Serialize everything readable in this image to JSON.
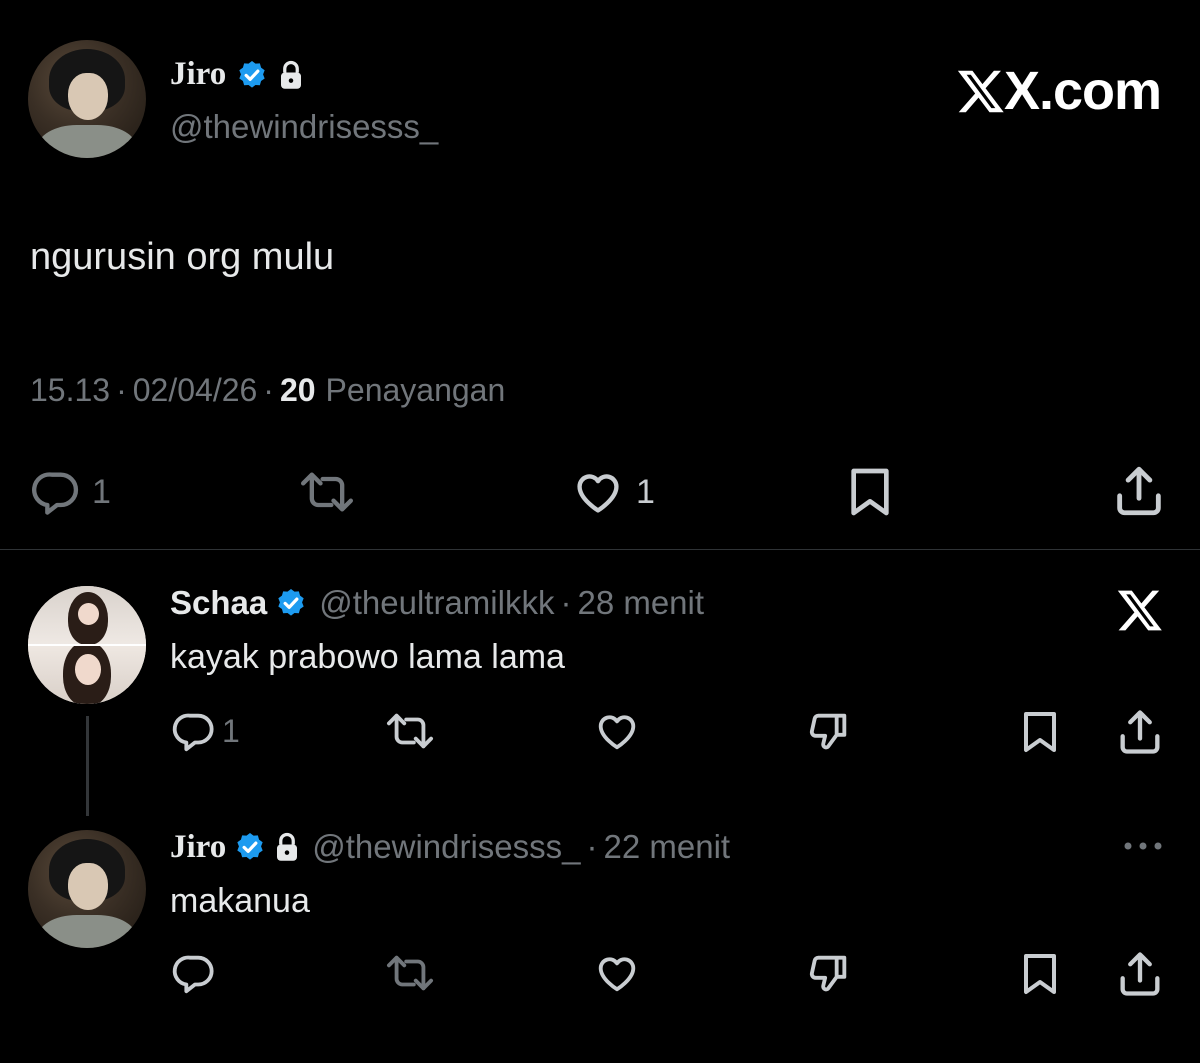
{
  "main_post": {
    "author_name": "Jiro",
    "handle": "@thewindrisesss_",
    "text": "ngurusin org mulu",
    "time": "15.13",
    "date": "02/04/26",
    "views_count": "20",
    "views_label": "Penayangan",
    "reply_count": "1",
    "like_count": "1"
  },
  "brand": {
    "watermark": "X.com"
  },
  "replies": [
    {
      "author_name": "Schaa",
      "handle": "@theultramilkkk",
      "time": "28 menit",
      "text": "kayak prabowo lama lama",
      "reply_count": "1"
    },
    {
      "author_name": "Jiro",
      "handle": "@thewindrisesss_",
      "time": "22 menit",
      "text": "makanua"
    }
  ],
  "separator": "·",
  "colors": {
    "background": "#000000",
    "text": "#e7e9ea",
    "muted": "#71767b",
    "verified": "#1d9bf0"
  },
  "icons": [
    "verified-badge-icon",
    "lock-icon",
    "reply-icon",
    "retweet-icon",
    "like-icon",
    "bookmark-icon",
    "share-icon",
    "dislike-icon",
    "more-icon",
    "x-logo-icon"
  ]
}
